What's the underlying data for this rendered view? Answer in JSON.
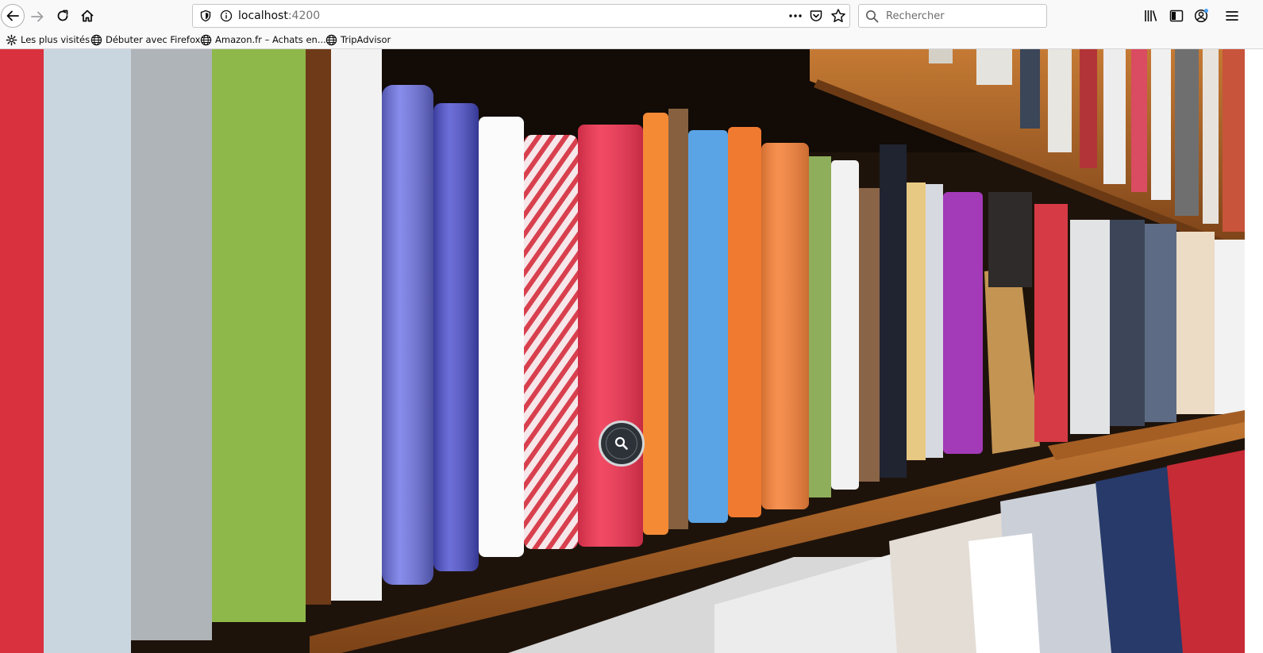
{
  "browser": {
    "url_host": "localhost",
    "url_port": ":4200",
    "search_placeholder": "Rechercher"
  },
  "bookmarks": [
    {
      "label": "Les plus visités",
      "icon": "gear-icon"
    },
    {
      "label": "Débuter avec Firefox",
      "icon": "globe-icon"
    },
    {
      "label": "Amazon.fr – Achats en...",
      "icon": "globe-icon"
    },
    {
      "label": "TripAdvisor",
      "icon": "globe-icon"
    }
  ],
  "page": {
    "hero_image": "bookshelf-photo",
    "zoom_icon": "magnifier-icon"
  },
  "colors": {
    "toolbar_bg": "#f9f9fa",
    "zoom_button_bg": "#2d3239"
  }
}
